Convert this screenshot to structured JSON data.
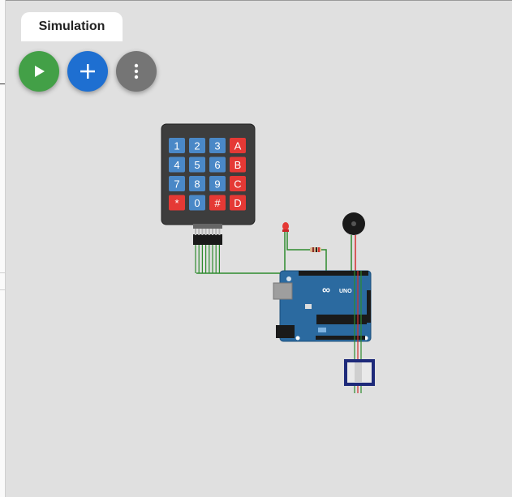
{
  "tab": {
    "label": "Simulation"
  },
  "toolbar": {
    "start_button_icon": "play-icon",
    "add_button_icon": "plus-icon",
    "more_button_icon": "more-vert-icon"
  },
  "keypad": {
    "keys": [
      [
        "1",
        "2",
        "3",
        "A"
      ],
      [
        "4",
        "5",
        "6",
        "B"
      ],
      [
        "7",
        "8",
        "9",
        "C"
      ],
      [
        "*",
        "0",
        "#",
        "D"
      ]
    ],
    "number_key_color": "#4a88c7",
    "letter_key_color": "#e53935"
  },
  "arduino": {
    "board_label": "UNO",
    "board_color": "#2b6aa0"
  },
  "colors": {
    "canvas": "#e0e0e0",
    "play": "#43a047",
    "add": "#1e6fd1",
    "more": "#757575",
    "wire_green": "#2e8b2e",
    "wire_red": "#d32f2f"
  }
}
